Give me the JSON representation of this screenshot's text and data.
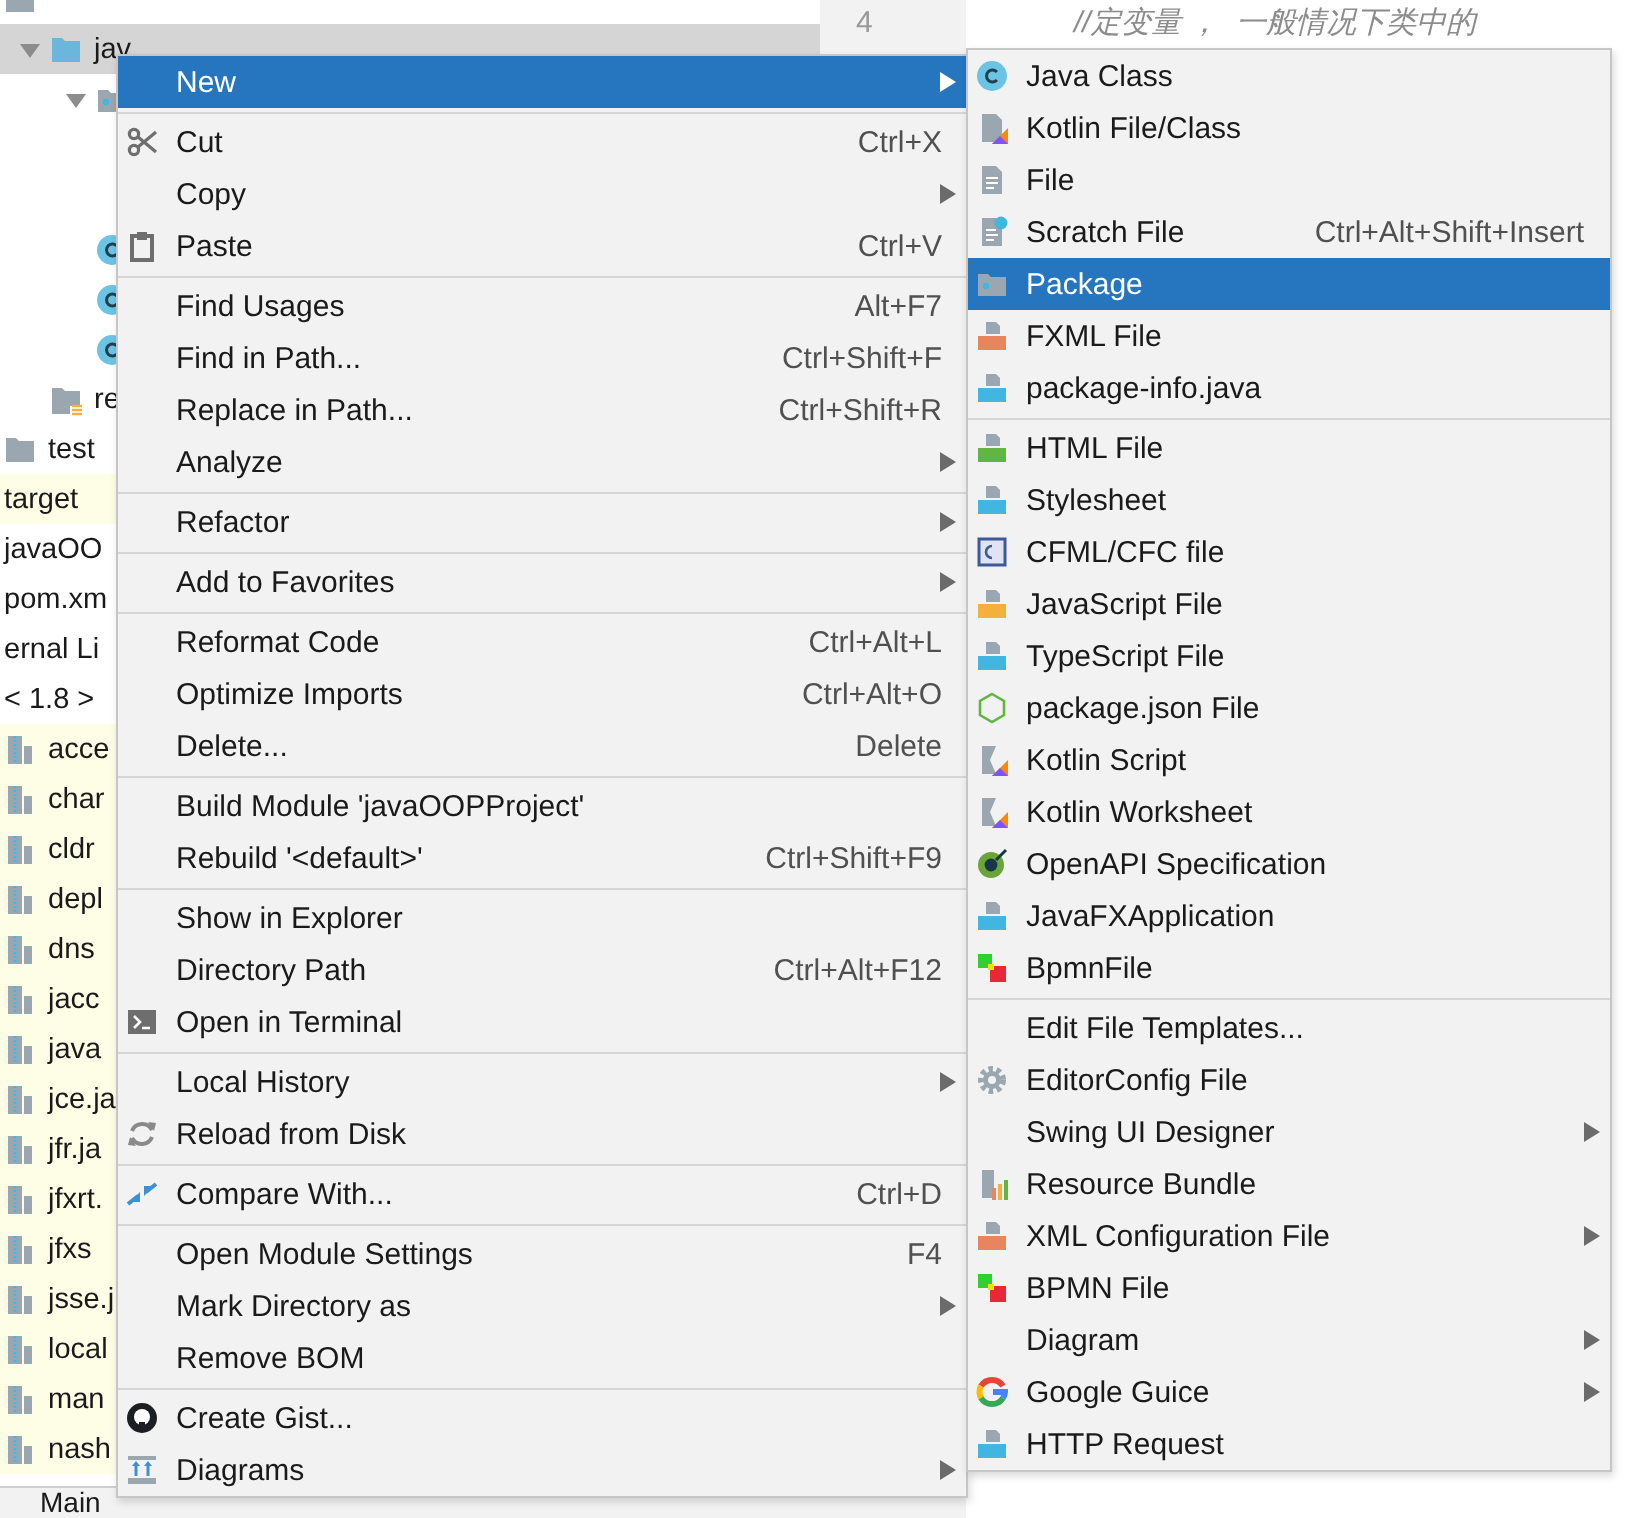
{
  "project_tree": {
    "items": [
      {
        "kind": "folder",
        "selected": false,
        "highlighted": false,
        "children": [
          {
            "label": "jav",
            "kind": "source-folder",
            "selected": true,
            "highlighted": false,
            "expanded": true,
            "children": [
              {
                "kind": "package",
                "selected": false,
                "highlighted": false,
                "expanded": true
              },
              {
                "kind": "class",
                "selected": false,
                "highlighted": false
              },
              {
                "kind": "class",
                "selected": false,
                "highlighted": false
              },
              {
                "kind": "class",
                "selected": false,
                "highlighted": false
              }
            ]
          },
          {
            "label": "re",
            "kind": "resources-folder",
            "selected": false,
            "highlighted": false
          }
        ]
      },
      {
        "label": "test",
        "kind": "folder",
        "selected": false,
        "highlighted": false
      },
      {
        "label": "target",
        "kind": "none",
        "selected": false,
        "highlighted": true
      },
      {
        "label": "javaOO",
        "kind": "none",
        "selected": false,
        "highlighted": false
      },
      {
        "label": "pom.xm",
        "kind": "none",
        "selected": false,
        "highlighted": false
      },
      {
        "label": "ernal Li",
        "kind": "none",
        "selected": false,
        "highlighted": false
      },
      {
        "label": "< 1.8 >",
        "kind": "none",
        "selected": false,
        "highlighted": false
      },
      {
        "label": "acce",
        "kind": "jar",
        "selected": false,
        "highlighted": true
      },
      {
        "label": "char",
        "kind": "jar",
        "selected": false,
        "highlighted": true
      },
      {
        "label": "cldr",
        "kind": "jar",
        "selected": false,
        "highlighted": true
      },
      {
        "label": "depl",
        "kind": "jar",
        "selected": false,
        "highlighted": true
      },
      {
        "label": "dns",
        "kind": "jar",
        "selected": false,
        "highlighted": true
      },
      {
        "label": "jacc",
        "kind": "jar",
        "selected": false,
        "highlighted": true
      },
      {
        "label": "java",
        "kind": "jar",
        "selected": false,
        "highlighted": true
      },
      {
        "label": "jce.ja",
        "kind": "jar",
        "selected": false,
        "highlighted": true
      },
      {
        "label": "jfr.ja",
        "kind": "jar",
        "selected": false,
        "highlighted": true
      },
      {
        "label": "jfxrt.",
        "kind": "jar",
        "selected": false,
        "highlighted": true
      },
      {
        "label": "jfxs",
        "kind": "jar",
        "selected": false,
        "highlighted": true
      },
      {
        "label": "jsse.j",
        "kind": "jar",
        "selected": false,
        "highlighted": true
      },
      {
        "label": "local",
        "kind": "jar",
        "selected": false,
        "highlighted": true
      },
      {
        "label": "man",
        "kind": "jar",
        "selected": false,
        "highlighted": true
      },
      {
        "label": "nash",
        "kind": "jar",
        "selected": false,
        "highlighted": true
      }
    ]
  },
  "bottom_tab": {
    "label": "Main"
  },
  "editor": {
    "lines": [
      {
        "number": "4",
        "text": "//定变量 ，  一般情况下类中的"
      }
    ]
  },
  "context_menu": {
    "sections": [
      {
        "items": [
          {
            "label": "New",
            "kind": "plain",
            "submenu": true,
            "selected": true
          }
        ]
      },
      {
        "items": [
          {
            "label": "Cut",
            "kind": "scissors",
            "shortcut": "Ctrl+X",
            "submenu": false,
            "selected": false
          },
          {
            "label": "Copy",
            "kind": "plain",
            "submenu": true,
            "selected": false
          },
          {
            "label": "Paste",
            "kind": "clipboard",
            "shortcut": "Ctrl+V",
            "submenu": false,
            "selected": false
          }
        ]
      },
      {
        "items": [
          {
            "label": "Find Usages",
            "kind": "plain",
            "shortcut": "Alt+F7",
            "submenu": false,
            "selected": false
          },
          {
            "label": "Find in Path...",
            "kind": "plain",
            "shortcut": "Ctrl+Shift+F",
            "submenu": false,
            "selected": false
          },
          {
            "label": "Replace in Path...",
            "kind": "plain",
            "shortcut": "Ctrl+Shift+R",
            "submenu": false,
            "selected": false
          },
          {
            "label": "Analyze",
            "kind": "plain",
            "submenu": true,
            "selected": false
          }
        ]
      },
      {
        "items": [
          {
            "label": "Refactor",
            "kind": "plain",
            "submenu": true,
            "selected": false
          }
        ]
      },
      {
        "items": [
          {
            "label": "Add to Favorites",
            "kind": "plain",
            "submenu": true,
            "selected": false
          }
        ]
      },
      {
        "items": [
          {
            "label": "Reformat Code",
            "kind": "plain",
            "shortcut": "Ctrl+Alt+L",
            "submenu": false,
            "selected": false
          },
          {
            "label": "Optimize Imports",
            "kind": "plain",
            "shortcut": "Ctrl+Alt+O",
            "submenu": false,
            "selected": false
          },
          {
            "label": "Delete...",
            "kind": "plain",
            "shortcut": "Delete",
            "submenu": false,
            "selected": false
          }
        ]
      },
      {
        "items": [
          {
            "label": "Build Module 'javaOOPProject'",
            "kind": "plain",
            "submenu": false,
            "selected": false
          },
          {
            "label": "Rebuild '<default>'",
            "kind": "plain",
            "shortcut": "Ctrl+Shift+F9",
            "submenu": false,
            "selected": false
          }
        ]
      },
      {
        "items": [
          {
            "label": "Show in Explorer",
            "kind": "plain",
            "submenu": false,
            "selected": false
          },
          {
            "label": "Directory Path",
            "kind": "plain",
            "shortcut": "Ctrl+Alt+F12",
            "submenu": false,
            "selected": false
          },
          {
            "label": "Open in Terminal",
            "kind": "terminal",
            "submenu": false,
            "selected": false
          }
        ]
      },
      {
        "items": [
          {
            "label": "Local History",
            "kind": "plain",
            "submenu": true,
            "selected": false
          },
          {
            "label": "Reload from Disk",
            "kind": "reload",
            "submenu": false,
            "selected": false
          }
        ]
      },
      {
        "items": [
          {
            "label": "Compare With...",
            "kind": "compare",
            "shortcut": "Ctrl+D",
            "submenu": false,
            "selected": false
          }
        ]
      },
      {
        "items": [
          {
            "label": "Open Module Settings",
            "kind": "plain",
            "shortcut": "F4",
            "submenu": false,
            "selected": false
          },
          {
            "label": "Mark Directory as",
            "kind": "plain",
            "submenu": true,
            "selected": false
          },
          {
            "label": "Remove BOM",
            "kind": "plain",
            "submenu": false,
            "selected": false
          }
        ]
      },
      {
        "items": [
          {
            "label": "Create Gist...",
            "kind": "round-logo",
            "submenu": false,
            "selected": false
          },
          {
            "label": "Diagrams",
            "kind": "diagrams",
            "submenu": true,
            "selected": false
          }
        ]
      }
    ]
  },
  "new_submenu": {
    "sections": [
      {
        "items": [
          {
            "label": "Java Class",
            "kind": "class",
            "submenu": false,
            "selected": false
          },
          {
            "label": "Kotlin File/Class",
            "kind": "kotlin-file",
            "submenu": false,
            "selected": false
          },
          {
            "label": "File",
            "kind": "file",
            "submenu": false,
            "selected": false
          },
          {
            "label": "Scratch File",
            "kind": "scratch",
            "shortcut": "Ctrl+Alt+Shift+Insert",
            "submenu": false,
            "selected": false
          },
          {
            "label": "Package",
            "kind": "package",
            "submenu": false,
            "selected": true
          },
          {
            "label": "FXML File",
            "kind": "xml",
            "submenu": false,
            "selected": false
          },
          {
            "label": "package-info.java",
            "kind": "java-file",
            "submenu": false,
            "selected": false
          }
        ]
      },
      {
        "items": [
          {
            "label": "HTML File",
            "kind": "html",
            "submenu": false,
            "selected": false
          },
          {
            "label": "Stylesheet",
            "kind": "css",
            "submenu": false,
            "selected": false
          },
          {
            "label": "CFML/CFC file",
            "kind": "cf",
            "submenu": false,
            "selected": false
          },
          {
            "label": "JavaScript File",
            "kind": "js",
            "submenu": false,
            "selected": false
          },
          {
            "label": "TypeScript File",
            "kind": "ts",
            "submenu": false,
            "selected": false
          },
          {
            "label": "package.json File",
            "kind": "hexagon",
            "submenu": false,
            "selected": false
          },
          {
            "label": "Kotlin Script",
            "kind": "kotlin-script",
            "submenu": false,
            "selected": false
          },
          {
            "label": "Kotlin Worksheet",
            "kind": "kotlin-script",
            "submenu": false,
            "selected": false
          },
          {
            "label": "OpenAPI Specification",
            "kind": "openapi",
            "submenu": false,
            "selected": false
          },
          {
            "label": "JavaFXApplication",
            "kind": "java-file",
            "submenu": false,
            "selected": false
          },
          {
            "label": "BpmnFile",
            "kind": "bpmn",
            "submenu": false,
            "selected": false
          }
        ]
      },
      {
        "items": [
          {
            "label": "Edit File Templates...",
            "kind": "plain",
            "submenu": false,
            "selected": false
          },
          {
            "label": "EditorConfig File",
            "kind": "gear",
            "submenu": false,
            "selected": false
          },
          {
            "label": "Swing UI Designer",
            "kind": "plain",
            "submenu": true,
            "selected": false
          },
          {
            "label": "Resource Bundle",
            "kind": "bundle",
            "submenu": false,
            "selected": false
          },
          {
            "label": "XML Configuration File",
            "kind": "xml",
            "submenu": true,
            "selected": false
          },
          {
            "label": "BPMN File",
            "kind": "bpmn",
            "submenu": false,
            "selected": false
          },
          {
            "label": "Diagram",
            "kind": "plain",
            "submenu": true,
            "selected": false
          },
          {
            "label": "Google Guice",
            "kind": "ring-logo",
            "submenu": true,
            "selected": false
          },
          {
            "label": "HTTP Request",
            "kind": "api",
            "submenu": false,
            "selected": false
          }
        ]
      }
    ]
  }
}
